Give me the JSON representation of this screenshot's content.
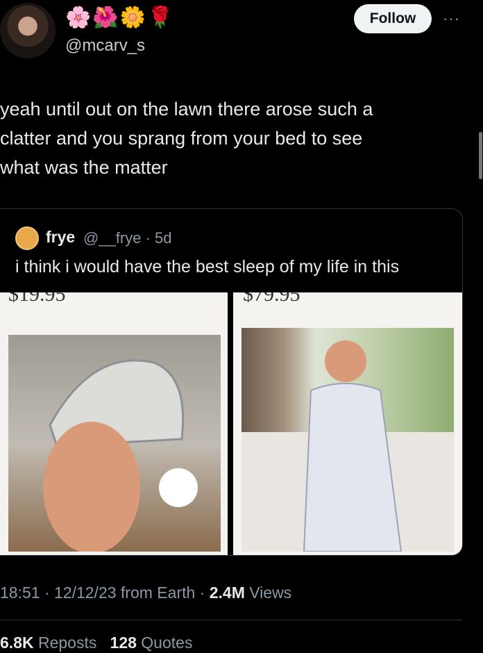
{
  "author": {
    "emoji_decor": "🌸🌺🌼🌹",
    "handle": "@mcarv_s",
    "follow_label": "Follow",
    "more_label": "···"
  },
  "tweet": {
    "text_line1": "yeah until out on the lawn there arose such a",
    "text_line2": "clatter and you sprang from your bed to see",
    "text_line3": "what was the matter"
  },
  "quote": {
    "name": "frye",
    "handle_time": "@__frye · 5d",
    "text": "i think i would have the best sleep of my life in this",
    "price_left": "$19.95",
    "price_right": "$79.95"
  },
  "meta": {
    "time_date": "18:51 · 12/12/23 from Earth ·",
    "views_count": "2.4M",
    "views_label": "Views"
  },
  "stats": {
    "reposts_count": "6.8K",
    "reposts_label": "Reposts",
    "quotes_count": "128",
    "quotes_label": "Quotes"
  }
}
